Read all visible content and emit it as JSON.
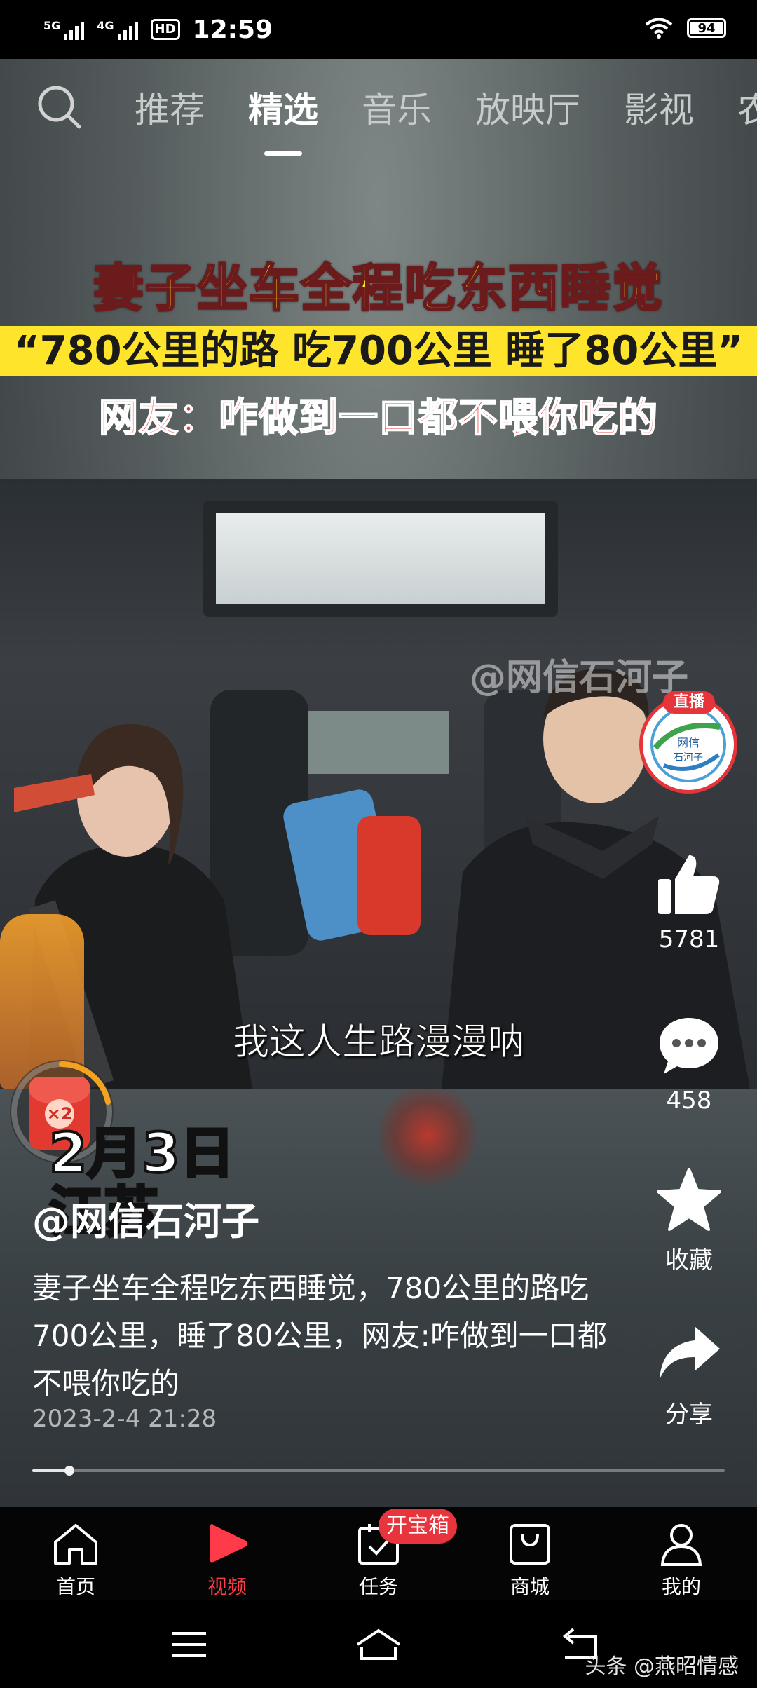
{
  "status_bar": {
    "signal1": "5G",
    "signal2": "4G",
    "hd": "HD",
    "time": "12:59",
    "battery": "94"
  },
  "nav": {
    "tabs": [
      "推荐",
      "精选",
      "音乐",
      "放映厅",
      "影视",
      "农"
    ],
    "active_tab": "精选"
  },
  "video": {
    "headline_line1": "妻子坐车全程吃东西睡觉",
    "headline_line2": "“780公里的路 吃700公里 睡了80公里”",
    "headline_line3": "网友：咋做到一口都不喂你吃的",
    "watermark": "@网信石河子",
    "subtitle": "我这人生路漫漫呐",
    "date_overlay_line1": "2月3日",
    "date_overlay_line2": "江苏",
    "author": "@网信石河子",
    "description": "妻子坐车全程吃东西睡觉，780公里的路吃700公里，睡了80公里，网友:咋做到一口都不喂你吃的",
    "timestamp": "2023-2-4 21:28",
    "progress_fraction": 0.054,
    "red_packet_label": "×2"
  },
  "actions": {
    "avatar_badge": "直播",
    "avatar_text_1": "网信",
    "avatar_text_2": "石河子",
    "like_count": "5781",
    "comment_count": "458",
    "favorite_label": "收藏",
    "share_label": "分享"
  },
  "bottom_nav": {
    "home": "首页",
    "video": "视频",
    "tasks": "任务",
    "tasks_badge": "开宝箱",
    "mall": "商城",
    "mine": "我的"
  },
  "credit": "头条 @燕昭情感",
  "colors": {
    "accent_red": "#ff3b49",
    "caption_yellow": "#ffe42c"
  }
}
